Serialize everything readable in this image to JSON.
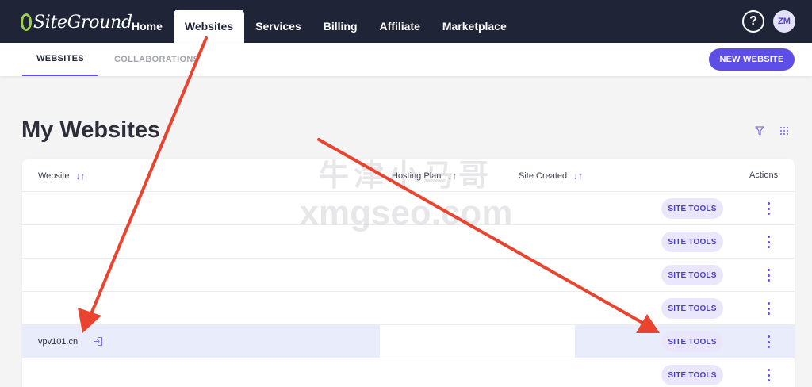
{
  "brand": {
    "logo_text": "SiteGround",
    "accent": "#5c4ee6",
    "nav_bg": "#1f2537"
  },
  "nav": {
    "items": [
      {
        "label": "Home"
      },
      {
        "label": "Websites"
      },
      {
        "label": "Services"
      },
      {
        "label": "Billing"
      },
      {
        "label": "Affiliate"
      },
      {
        "label": "Marketplace"
      }
    ],
    "active": "Websites",
    "help_icon": "?",
    "avatar_initials": "ZM"
  },
  "subnav": {
    "tabs": [
      {
        "label": "WEBSITES"
      },
      {
        "label": "COLLABORATIONS"
      }
    ],
    "active": "WEBSITES",
    "new_website_label": "NEW WEBSITE"
  },
  "page": {
    "title": "My Websites",
    "icons": [
      "filter-icon",
      "grid-view-icon"
    ]
  },
  "table": {
    "columns": [
      "Website",
      "Hosting Plan",
      "Site Created",
      "Actions"
    ],
    "rows": [
      {
        "website": "",
        "site_tools": "SITE TOOLS"
      },
      {
        "website": "",
        "site_tools": "SITE TOOLS"
      },
      {
        "website": "",
        "site_tools": "SITE TOOLS"
      },
      {
        "website": "",
        "site_tools": "SITE TOOLS"
      },
      {
        "website": "vpv101.cn",
        "site_tools": "SITE TOOLS",
        "highlighted": true
      },
      {
        "website": "",
        "site_tools": "SITE TOOLS"
      }
    ]
  },
  "watermark": {
    "line1": "牛津小马哥",
    "line2": "xmgseo.com"
  },
  "annotation_color": "#e8442f"
}
